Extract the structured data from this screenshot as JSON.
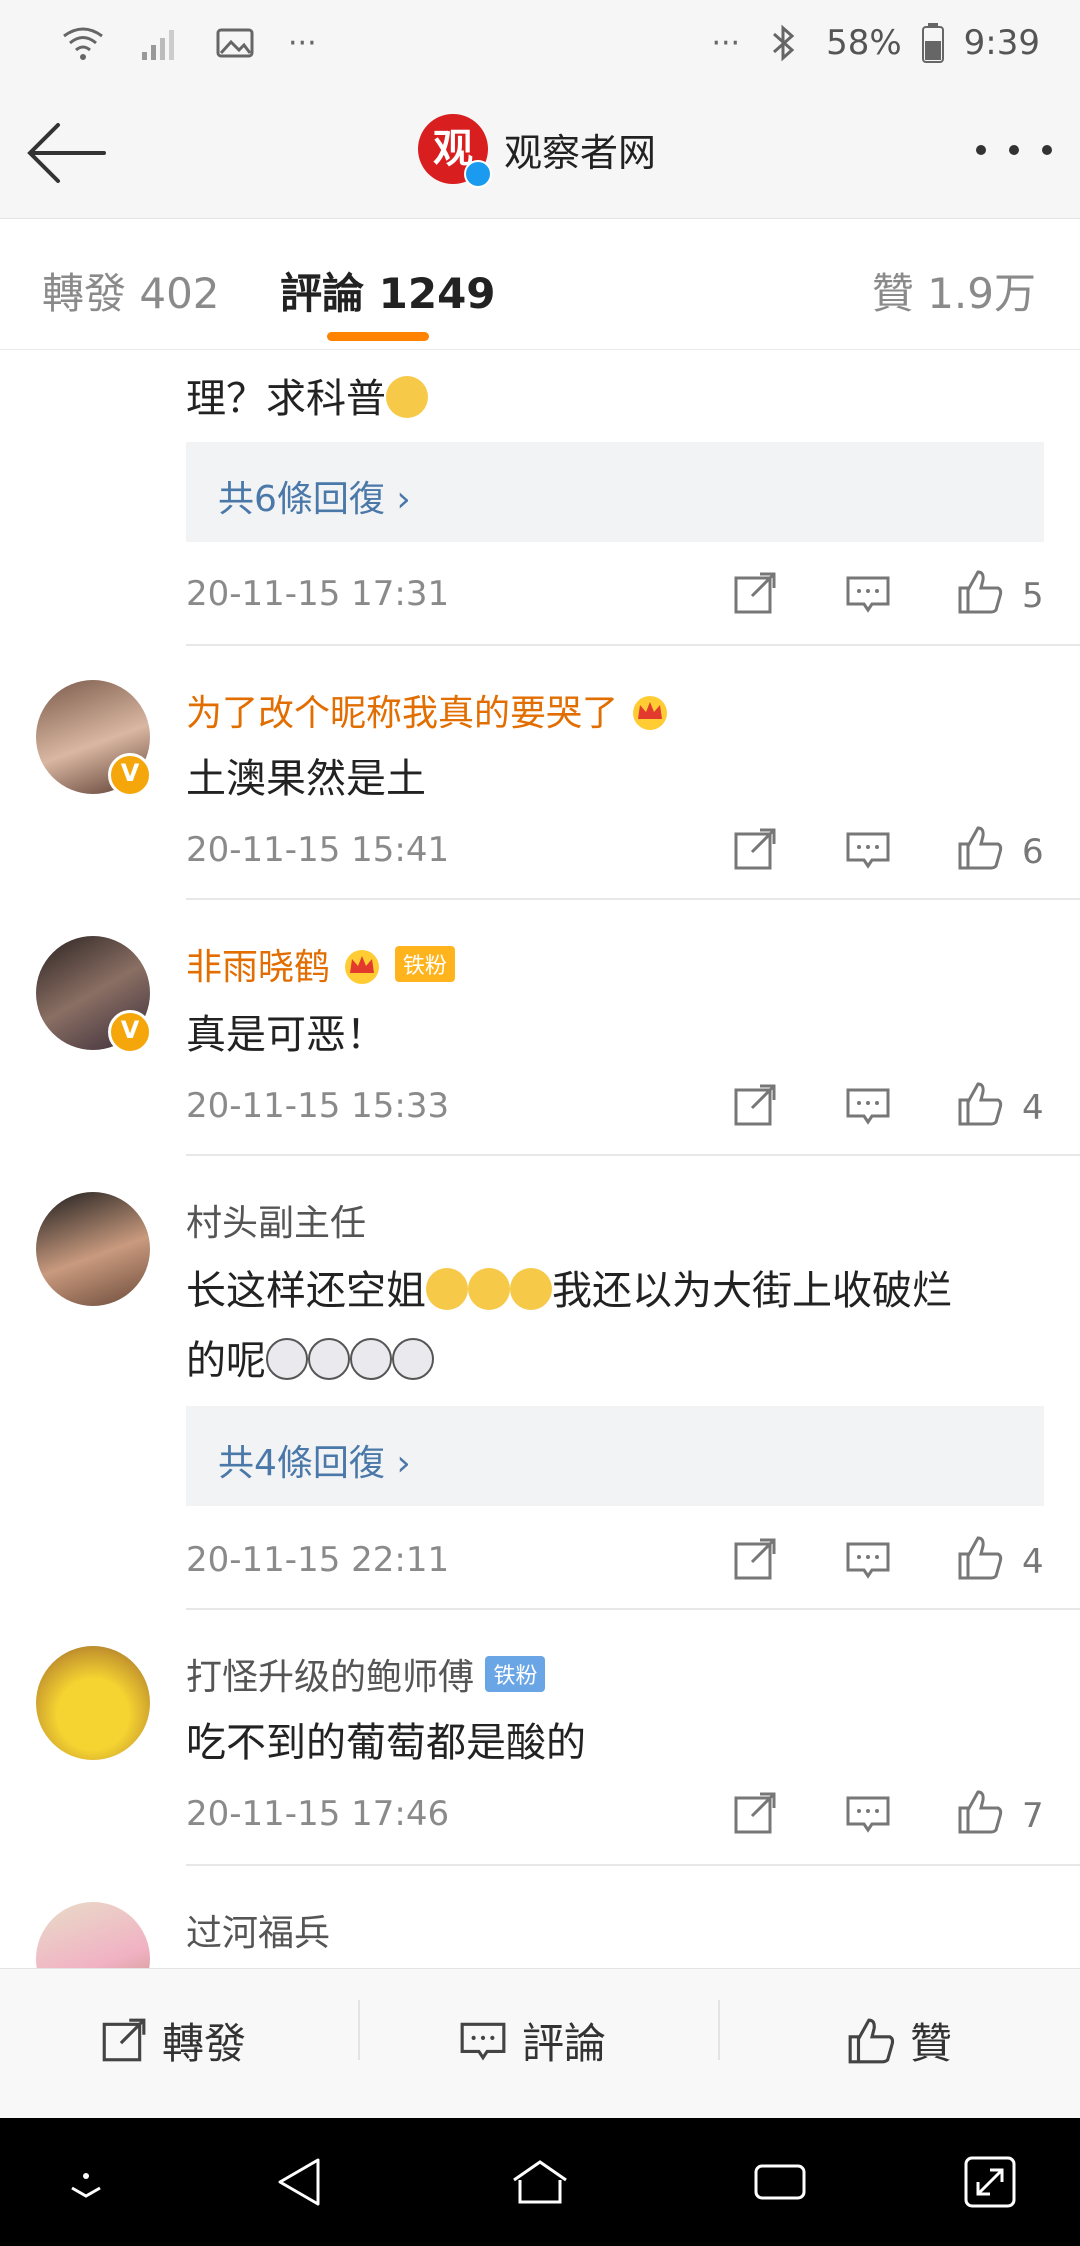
{
  "status_bar": {
    "battery": "58%",
    "time": "9:39",
    "left_dots": "···",
    "right_dots": "···"
  },
  "header": {
    "title": "观察者网",
    "logo_char": "观"
  },
  "tabs": {
    "forward": "轉發 402",
    "comment": "評論 1249",
    "like": "贊 1.9万"
  },
  "comments": [
    {
      "text": "理？求科普",
      "replies": "共6條回復 ›",
      "date": "20-11-15 17:31",
      "likes": "5"
    },
    {
      "name": "为了改个昵称我真的要哭了",
      "text": "土澳果然是土",
      "date": "20-11-15 15:41",
      "likes": "6",
      "verify": "V"
    },
    {
      "name": "非雨晓鹤",
      "badge": "铁粉",
      "text": "真是可恶！",
      "date": "20-11-15 15:33",
      "likes": "4",
      "verify": "V"
    },
    {
      "name": "村头副主任",
      "text_part1": "长这样还空姐",
      "text_part2": "我还以为大街上收破烂",
      "text_part3": "的呢",
      "replies": "共4條回復 ›",
      "date": "20-11-15 22:11",
      "likes": "4"
    },
    {
      "name": "打怪升级的鲍师傅",
      "badge": "铁粉",
      "text": "吃不到的葡萄都是酸的",
      "date": "20-11-15 17:46",
      "likes": "7"
    },
    {
      "name": "过河福兵"
    }
  ],
  "bottom_bar": {
    "forward": "轉發",
    "comment": "評論",
    "like": "贊"
  },
  "colors": {
    "accent_orange": "#ff8200",
    "name_orange": "#e26d00",
    "link_blue": "#4a78a8"
  }
}
